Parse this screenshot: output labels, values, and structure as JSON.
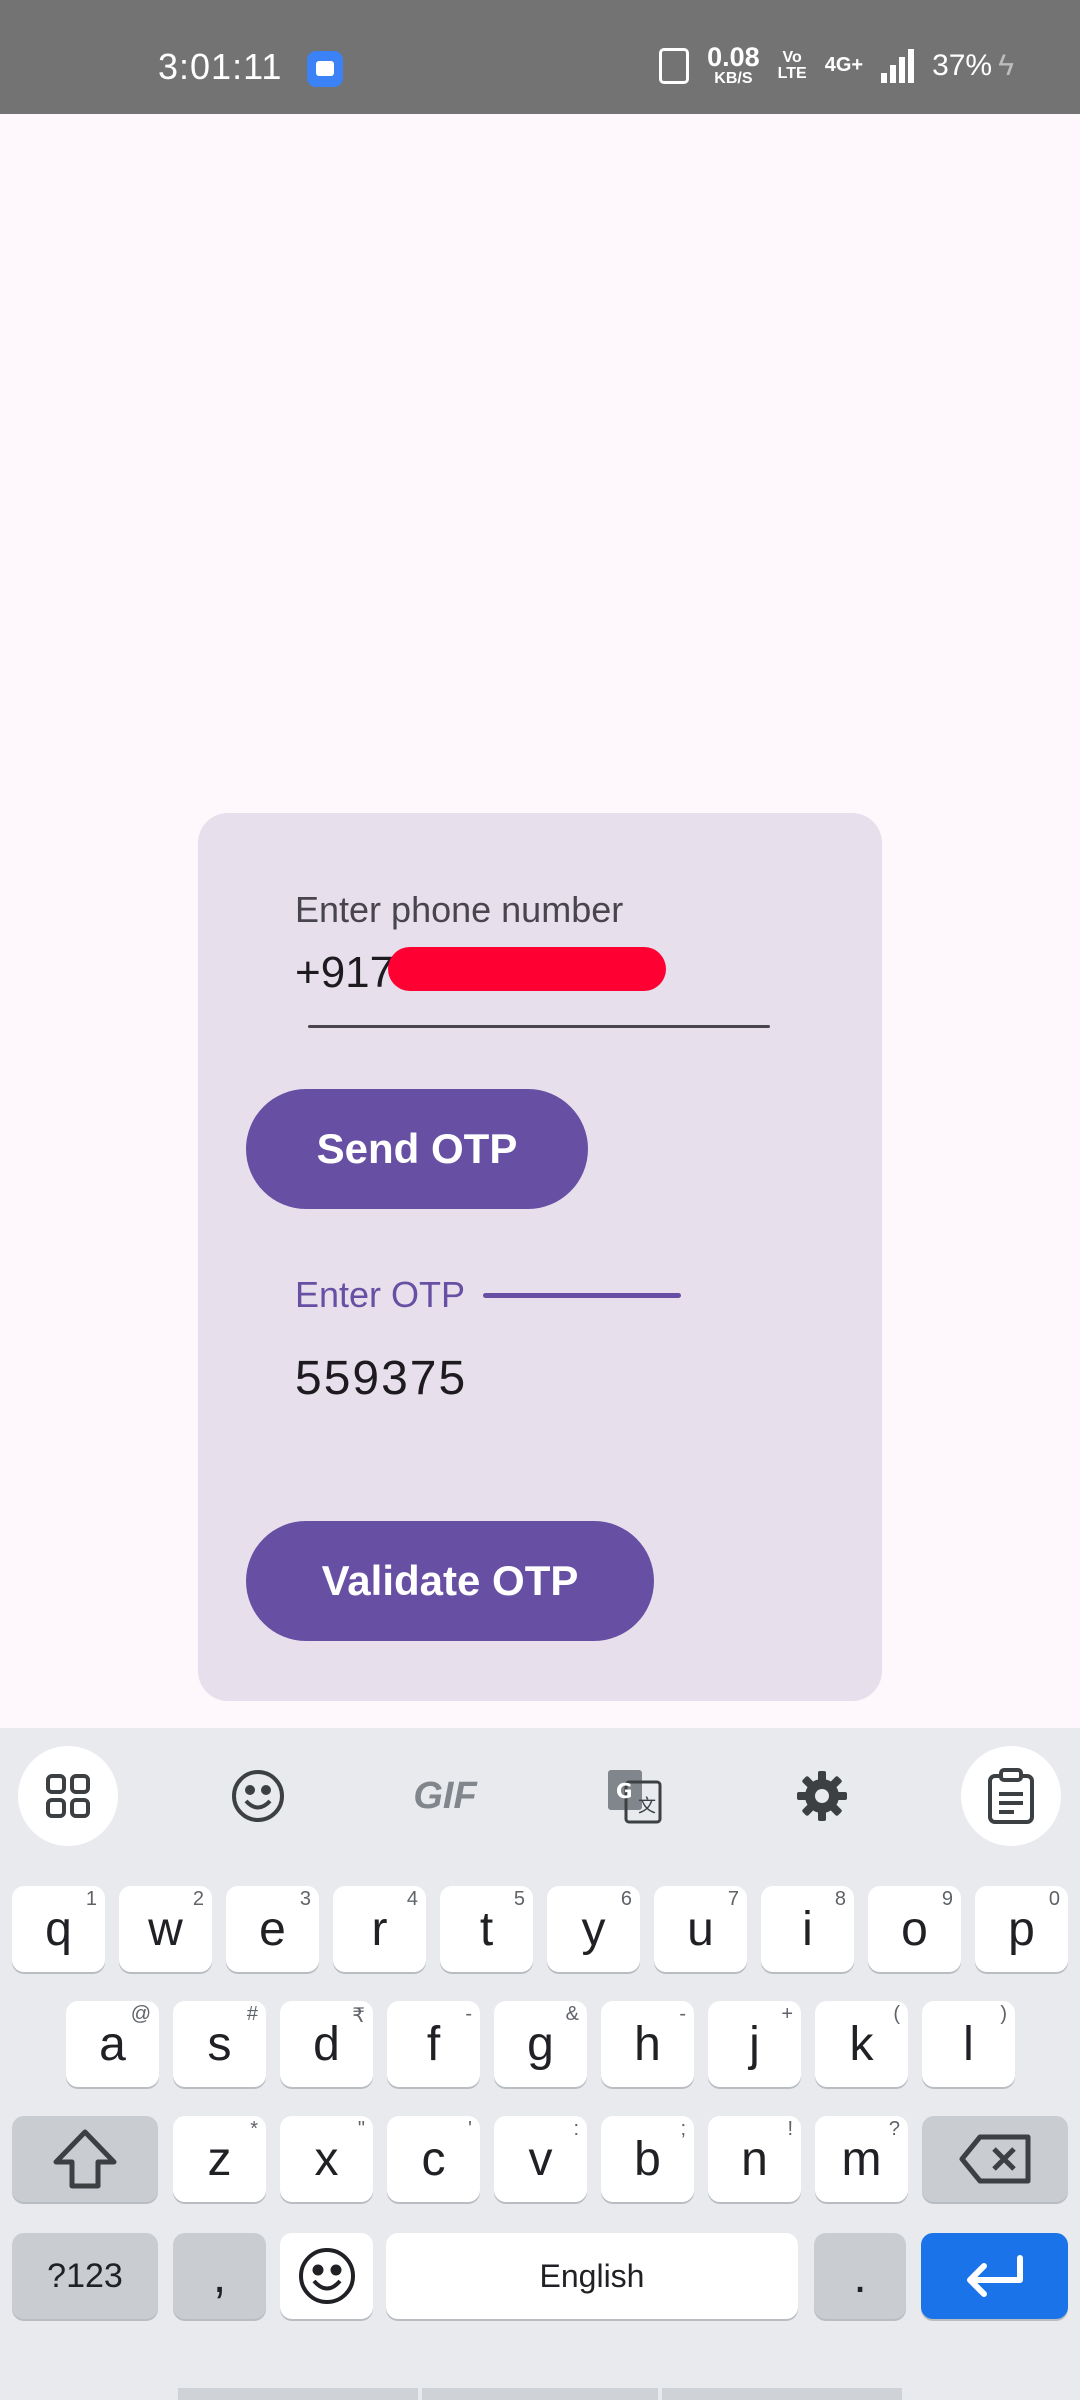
{
  "status_bar": {
    "time": "3:01:11",
    "net_speed": "0.08",
    "net_unit": "KB/S",
    "volte_top": "Vo",
    "volte_bottom": "LTE",
    "network": "4G+",
    "battery": "37%"
  },
  "form": {
    "phone_label": "Enter phone number",
    "phone_value_visible": "+917",
    "send_button": "Send OTP",
    "otp_label": "Enter OTP",
    "otp_value": "559375",
    "validate_button": "Validate OTP"
  },
  "keyboard": {
    "toolbar": [
      "apps-grid-icon",
      "emoji-icon",
      "GIF",
      "translate-icon",
      "settings-gear-icon",
      "clipboard-icon"
    ],
    "gif_label": "GIF",
    "row1": [
      {
        "k": "q",
        "h": "1"
      },
      {
        "k": "w",
        "h": "2"
      },
      {
        "k": "e",
        "h": "3"
      },
      {
        "k": "r",
        "h": "4"
      },
      {
        "k": "t",
        "h": "5"
      },
      {
        "k": "y",
        "h": "6"
      },
      {
        "k": "u",
        "h": "7"
      },
      {
        "k": "i",
        "h": "8"
      },
      {
        "k": "o",
        "h": "9"
      },
      {
        "k": "p",
        "h": "0"
      }
    ],
    "row2": [
      {
        "k": "a",
        "h": "@"
      },
      {
        "k": "s",
        "h": "#"
      },
      {
        "k": "d",
        "h": "₹"
      },
      {
        "k": "f",
        "h": "-"
      },
      {
        "k": "g",
        "h": "&"
      },
      {
        "k": "h",
        "h": "-"
      },
      {
        "k": "j",
        "h": "+"
      },
      {
        "k": "k",
        "h": "("
      },
      {
        "k": "l",
        "h": ")"
      }
    ],
    "row3": [
      {
        "k": "z",
        "h": "*"
      },
      {
        "k": "x",
        "h": "\""
      },
      {
        "k": "c",
        "h": "'"
      },
      {
        "k": "v",
        "h": ":"
      },
      {
        "k": "b",
        "h": ";"
      },
      {
        "k": "n",
        "h": "!"
      },
      {
        "k": "m",
        "h": "?"
      }
    ],
    "symbols_key": "?123",
    "comma_key": ",",
    "space_label": "English",
    "period_key": "."
  },
  "colors": {
    "primary": "#6750a4",
    "card": "#e7e0ec",
    "background": "#fef7fc",
    "redaction": "#ff0033",
    "enter_key": "#1a73e8"
  }
}
